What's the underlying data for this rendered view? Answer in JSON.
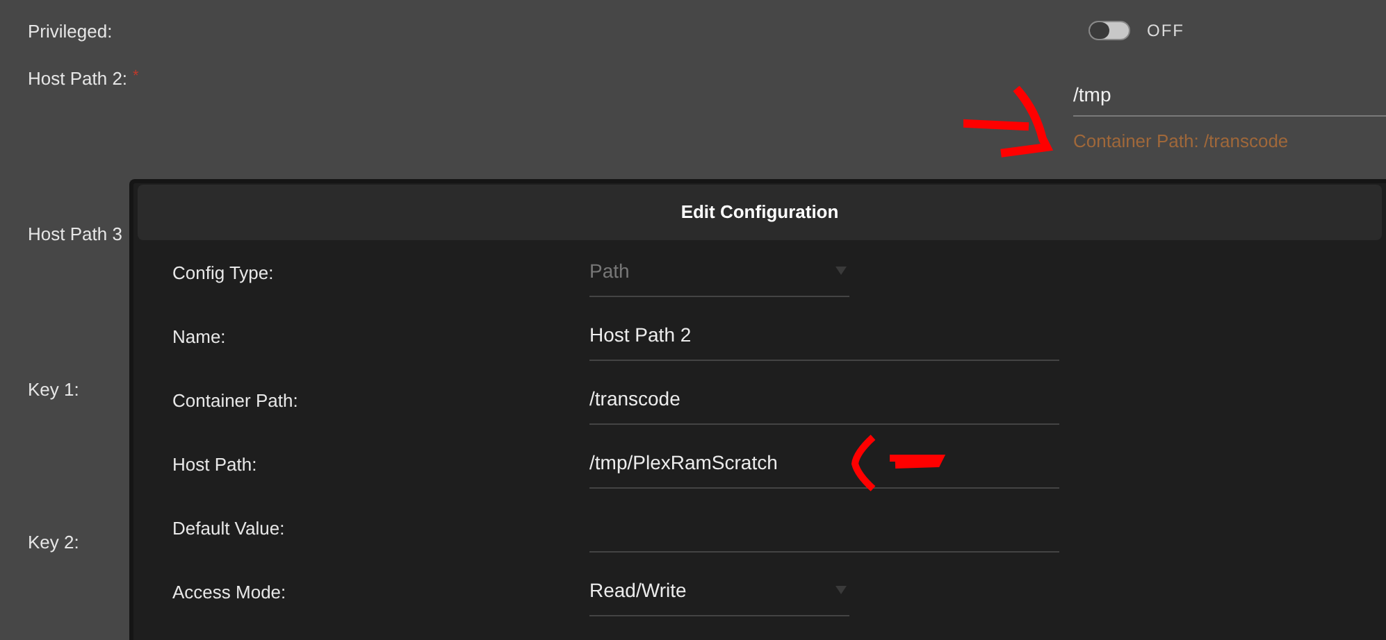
{
  "background_form": {
    "fields": [
      {
        "kind": "toggle",
        "label": "Privileged:",
        "on": false,
        "state_text": "OFF"
      },
      {
        "kind": "path",
        "label": "Host Path 2:",
        "required_mark": "*",
        "value": "/tmp",
        "hint": "Container Path: /transcode"
      },
      {
        "kind": "label",
        "label": "Host Path 3"
      },
      {
        "kind": "label",
        "label": "Key 1:"
      },
      {
        "kind": "label",
        "label": "Key 2:"
      }
    ]
  },
  "dialog": {
    "title": "Edit Configuration",
    "rows": [
      {
        "kind": "select",
        "label": "Config Type:",
        "value": "Path",
        "disabled": true
      },
      {
        "kind": "input",
        "label": "Name:",
        "value": "Host Path 2"
      },
      {
        "kind": "input",
        "label": "Container Path:",
        "value": "/transcode"
      },
      {
        "kind": "input",
        "label": "Host Path:",
        "value": "/tmp/PlexRamScratch"
      },
      {
        "kind": "input",
        "label": "Default Value:",
        "value": ""
      },
      {
        "kind": "select",
        "label": "Access Mode:",
        "value": "Read/Write",
        "disabled": false
      }
    ]
  }
}
